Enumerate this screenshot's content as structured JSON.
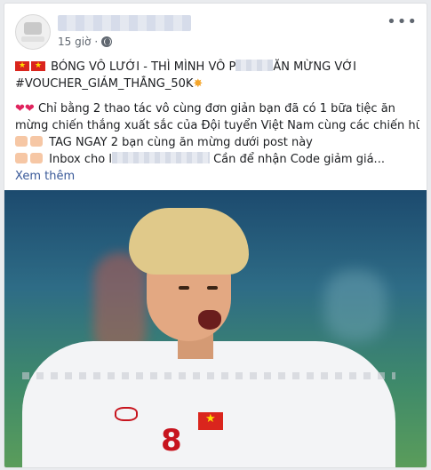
{
  "post": {
    "timestamp": "15 giờ",
    "more_label": "•••",
    "lines": {
      "l1_a": "BÓNG VÔ LƯỚI - THÌ MÌNH VÔ P",
      "l1_b": "ĂN MỪNG VỚI",
      "l2": "#VOUCHER_GIẢM_THẮNG_50K",
      "l3": "Chỉ bằng 2 thao tác vô cùng đơn giản bạn đã có 1 bữa tiệc ăn",
      "l4": "mừng chiến thắng xuất sắc của Đội tuyển Việt Nam cùng các chiến hữu",
      "l5": "TAG NGAY 2 bạn cùng ăn mừng dưới post này",
      "l6_a": "Inbox cho l",
      "l6_b": "Cần để nhận Code giảm giá..."
    },
    "see_more": "Xem thêm",
    "shirt_number": "8"
  },
  "icons": {
    "flag": "vietnam-flag-icon",
    "heart": "red-heart-icon",
    "hand": "pointing-hand-icon",
    "globe": "globe-icon",
    "sparkle": "sparkle-icon"
  },
  "colors": {
    "link": "#385898",
    "heart": "#e0245e",
    "flag_red": "#da251d",
    "flag_star": "#ffde00"
  }
}
